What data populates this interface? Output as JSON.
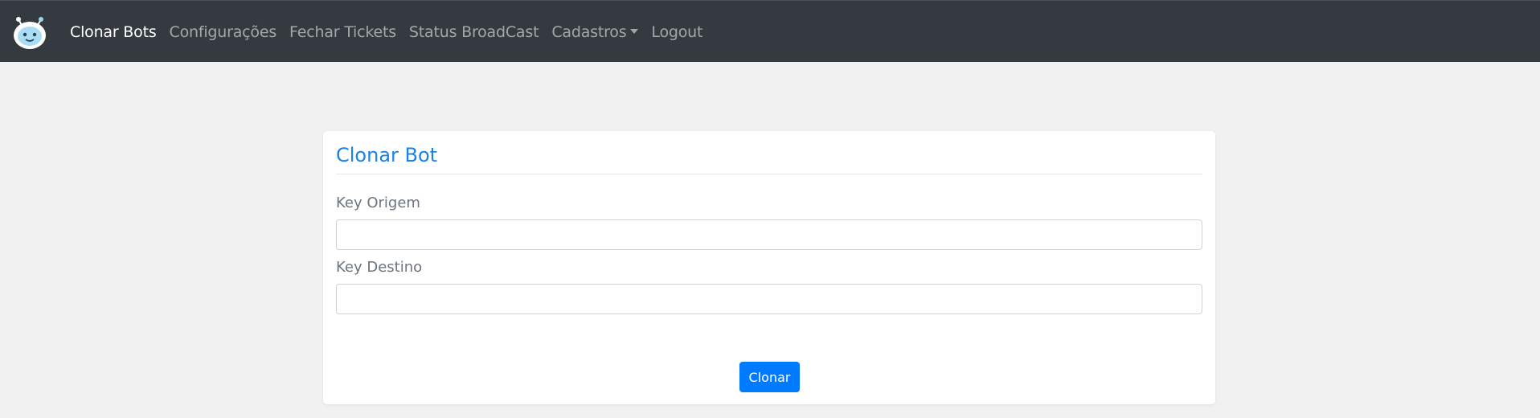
{
  "navbar": {
    "logo_icon": "robot-face-icon",
    "links": [
      {
        "label": "Clonar Bots",
        "active": true
      },
      {
        "label": "Configurações",
        "active": false
      },
      {
        "label": "Fechar Tickets",
        "active": false
      },
      {
        "label": "Status BroadCast",
        "active": false
      },
      {
        "label": "Cadastros",
        "active": false,
        "dropdown": true
      },
      {
        "label": "Logout",
        "active": false
      }
    ]
  },
  "card": {
    "title": "Clonar Bot",
    "fields": [
      {
        "label": "Key Origem",
        "value": "",
        "placeholder": ""
      },
      {
        "label": "Key Destino",
        "value": "",
        "placeholder": ""
      }
    ],
    "submit_label": "Clonar"
  },
  "colors": {
    "navbar_bg": "#343a40",
    "page_bg": "#f1f1f1",
    "accent": "#007bff",
    "title": "#1a82e8"
  }
}
